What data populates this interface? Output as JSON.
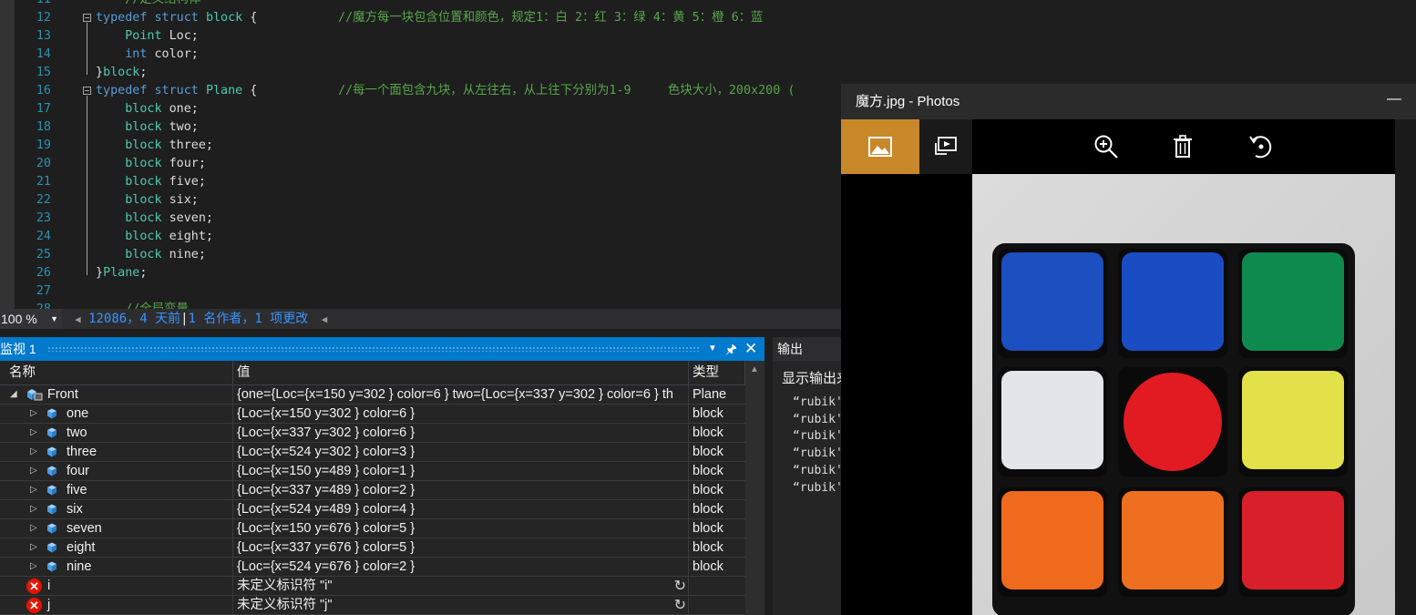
{
  "editor": {
    "lines": [
      {
        "num": "11",
        "segments": [
          {
            "t": "    ",
            "c": ""
          },
          {
            "t": "//定义结构体",
            "c": "cm"
          }
        ],
        "fold": false
      },
      {
        "num": "12",
        "segments": [
          {
            "t": "typedef struct ",
            "c": "kw"
          },
          {
            "t": "block",
            "c": "ty"
          },
          {
            "t": " {           ",
            "c": ""
          },
          {
            "t": "//魔方每一块包含位置和颜色，规定1：白 2：红 3：绿 4：黄 5：橙 6：蓝",
            "c": "cm"
          }
        ],
        "fold": true
      },
      {
        "num": "13",
        "segments": [
          {
            "t": "    ",
            "c": ""
          },
          {
            "t": "Point",
            "c": "ty"
          },
          {
            "t": " Loc;",
            "c": ""
          }
        ],
        "fold": false
      },
      {
        "num": "14",
        "segments": [
          {
            "t": "    ",
            "c": ""
          },
          {
            "t": "int",
            "c": "kw"
          },
          {
            "t": " color;",
            "c": ""
          }
        ],
        "fold": false
      },
      {
        "num": "15",
        "segments": [
          {
            "t": "}",
            "c": ""
          },
          {
            "t": "block",
            "c": "ty"
          },
          {
            "t": ";",
            "c": ""
          }
        ],
        "fold": false
      },
      {
        "num": "16",
        "segments": [
          {
            "t": "typedef struct ",
            "c": "kw"
          },
          {
            "t": "Plane",
            "c": "ty"
          },
          {
            "t": " {           ",
            "c": ""
          },
          {
            "t": "//每一个面包含九块，从左往右，从上往下分别为1-9     色块大小，200x200 (",
            "c": "cm"
          }
        ],
        "fold": true
      },
      {
        "num": "17",
        "segments": [
          {
            "t": "    ",
            "c": ""
          },
          {
            "t": "block",
            "c": "ty"
          },
          {
            "t": " one;",
            "c": ""
          }
        ],
        "fold": false
      },
      {
        "num": "18",
        "segments": [
          {
            "t": "    ",
            "c": ""
          },
          {
            "t": "block",
            "c": "ty"
          },
          {
            "t": " two;",
            "c": ""
          }
        ],
        "fold": false
      },
      {
        "num": "19",
        "segments": [
          {
            "t": "    ",
            "c": ""
          },
          {
            "t": "block",
            "c": "ty"
          },
          {
            "t": " three;",
            "c": ""
          }
        ],
        "fold": false
      },
      {
        "num": "20",
        "segments": [
          {
            "t": "    ",
            "c": ""
          },
          {
            "t": "block",
            "c": "ty"
          },
          {
            "t": " four;",
            "c": ""
          }
        ],
        "fold": false
      },
      {
        "num": "21",
        "segments": [
          {
            "t": "    ",
            "c": ""
          },
          {
            "t": "block",
            "c": "ty"
          },
          {
            "t": " five;",
            "c": ""
          }
        ],
        "fold": false
      },
      {
        "num": "22",
        "segments": [
          {
            "t": "    ",
            "c": ""
          },
          {
            "t": "block",
            "c": "ty"
          },
          {
            "t": " six;",
            "c": ""
          }
        ],
        "fold": false
      },
      {
        "num": "23",
        "segments": [
          {
            "t": "    ",
            "c": ""
          },
          {
            "t": "block",
            "c": "ty"
          },
          {
            "t": " seven;",
            "c": ""
          }
        ],
        "fold": false
      },
      {
        "num": "24",
        "segments": [
          {
            "t": "    ",
            "c": ""
          },
          {
            "t": "block",
            "c": "ty"
          },
          {
            "t": " eight;",
            "c": ""
          }
        ],
        "fold": false
      },
      {
        "num": "25",
        "segments": [
          {
            "t": "    ",
            "c": ""
          },
          {
            "t": "block",
            "c": "ty"
          },
          {
            "t": " nine;",
            "c": ""
          }
        ],
        "fold": false
      },
      {
        "num": "26",
        "segments": [
          {
            "t": "}",
            "c": ""
          },
          {
            "t": "Plane",
            "c": "ty"
          },
          {
            "t": ";",
            "c": ""
          }
        ],
        "fold": false
      },
      {
        "num": "27",
        "segments": [],
        "fold": false
      },
      {
        "num": "28",
        "segments": [
          {
            "t": "    ",
            "c": ""
          },
          {
            "t": "//全局变量",
            "c": "cm"
          }
        ],
        "fold": false
      }
    ],
    "zoom": "100 %",
    "codelens": {
      "changes": "12086，4 天前",
      "authors": "1 名作者，1 项更改"
    }
  },
  "watch": {
    "title": "监视 1",
    "columns": {
      "name": "名称",
      "value": "值",
      "type": "类型"
    },
    "rows": [
      {
        "name": "Front",
        "value": "{one={Loc={x=150 y=302 } color=6 } two={Loc={x=337 y=302 } color=6 } th",
        "type": "Plane",
        "kind": "root"
      },
      {
        "name": "one",
        "value": "{Loc={x=150 y=302 } color=6 }",
        "type": "block",
        "kind": "child"
      },
      {
        "name": "two",
        "value": "{Loc={x=337 y=302 } color=6 }",
        "type": "block",
        "kind": "child"
      },
      {
        "name": "three",
        "value": "{Loc={x=524 y=302 } color=3 }",
        "type": "block",
        "kind": "child"
      },
      {
        "name": "four",
        "value": "{Loc={x=150 y=489 } color=1 }",
        "type": "block",
        "kind": "child"
      },
      {
        "name": "five",
        "value": "{Loc={x=337 y=489 } color=2 }",
        "type": "block",
        "kind": "child"
      },
      {
        "name": "six",
        "value": "{Loc={x=524 y=489 } color=4 }",
        "type": "block",
        "kind": "child"
      },
      {
        "name": "seven",
        "value": "{Loc={x=150 y=676 } color=5 }",
        "type": "block",
        "kind": "child"
      },
      {
        "name": "eight",
        "value": "{Loc={x=337 y=676 } color=5 }",
        "type": "block",
        "kind": "child"
      },
      {
        "name": "nine",
        "value": "{Loc={x=524 y=676 } color=2 }",
        "type": "block",
        "kind": "child"
      },
      {
        "name": "i",
        "value": "未定义标识符 \"i\"",
        "type": "",
        "kind": "error"
      },
      {
        "name": "j",
        "value": "未定义标识符 \"j\"",
        "type": "",
        "kind": "error"
      }
    ]
  },
  "output": {
    "title": "输出",
    "show_label": "显示输出来",
    "lines": [
      "“rubik'",
      "“rubik'",
      "“rubik'",
      "“rubik'",
      "“rubik'",
      "“rubik'"
    ]
  },
  "photos": {
    "title": "魔方.jpg - Photos",
    "toolbar_icons": [
      "image-icon",
      "slideshow-icon",
      "zoom-in-icon",
      "delete-icon",
      "rotate-icon"
    ],
    "cube_faces": [
      {
        "row": 0,
        "col": 0,
        "color": "#1c4fc0",
        "shape": "square"
      },
      {
        "row": 0,
        "col": 1,
        "color": "#1a4cc4",
        "shape": "square"
      },
      {
        "row": 0,
        "col": 2,
        "color": "#0e8a4e",
        "shape": "square"
      },
      {
        "row": 1,
        "col": 0,
        "color": "#e2e6ea",
        "shape": "square"
      },
      {
        "row": 1,
        "col": 1,
        "color": "#e21b22",
        "shape": "circle"
      },
      {
        "row": 1,
        "col": 2,
        "color": "#e3e14a",
        "shape": "square"
      },
      {
        "row": 2,
        "col": 0,
        "color": "#f06a1e",
        "shape": "square"
      },
      {
        "row": 2,
        "col": 1,
        "color": "#ef6f20",
        "shape": "square"
      },
      {
        "row": 2,
        "col": 2,
        "color": "#d8202a",
        "shape": "square"
      }
    ]
  },
  "colors": {
    "accent": "#007acc",
    "photos_accent": "#c8882a"
  }
}
